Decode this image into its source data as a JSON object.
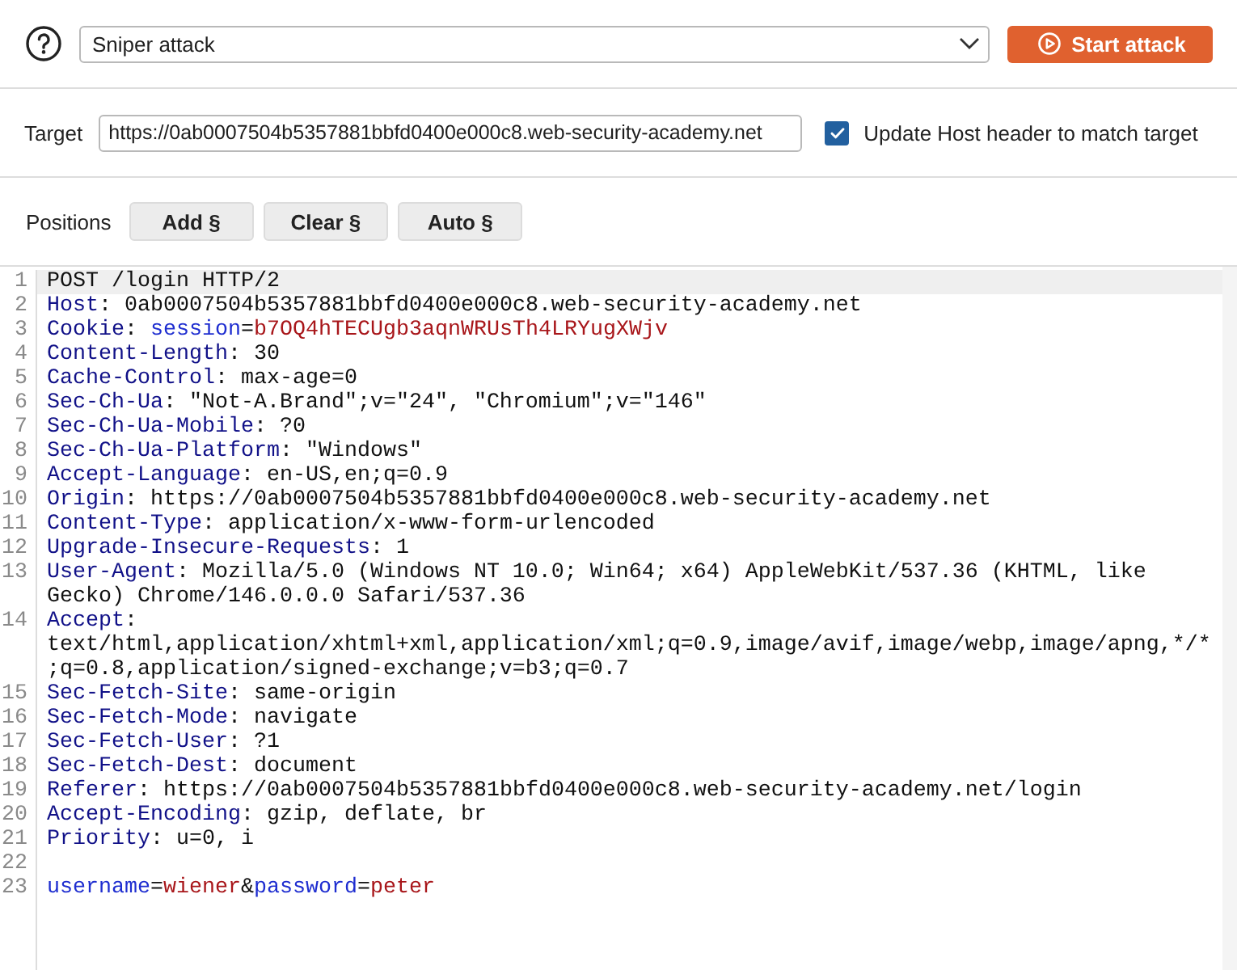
{
  "attack_type": {
    "value": "Sniper attack"
  },
  "start_attack": {
    "label": "Start attack"
  },
  "target": {
    "label": "Target",
    "value": "https://0ab0007504b5357881bbfd0400e000c8.web-security-academy.net",
    "update_host": {
      "label": "Update Host header to match target",
      "checked": true
    }
  },
  "positions": {
    "label": "Positions",
    "buttons": [
      {
        "label": "Add §"
      },
      {
        "label": "Clear §"
      },
      {
        "label": "Auto §"
      }
    ]
  },
  "editor": {
    "lines": [
      {
        "number": "1",
        "highlighted": true,
        "segments": [
          {
            "kind": "plain",
            "text": "POST /login HTTP/2"
          }
        ]
      },
      {
        "number": "2",
        "highlighted": false,
        "segments": [
          {
            "kind": "name",
            "text": "Host"
          },
          {
            "kind": "plain",
            "text": ": 0ab0007504b5357881bbfd0400e000c8.web-security-academy.net"
          }
        ]
      },
      {
        "number": "3",
        "highlighted": false,
        "segments": [
          {
            "kind": "name",
            "text": "Cookie"
          },
          {
            "kind": "plain",
            "text": ": "
          },
          {
            "kind": "param",
            "text": "session"
          },
          {
            "kind": "plain",
            "text": "="
          },
          {
            "kind": "value",
            "text": "b7OQ4hTECUgb3aqnWRUsTh4LRYugXWjv"
          }
        ]
      },
      {
        "number": "4",
        "highlighted": false,
        "segments": [
          {
            "kind": "name",
            "text": "Content-Length"
          },
          {
            "kind": "plain",
            "text": ": 30"
          }
        ]
      },
      {
        "number": "5",
        "highlighted": false,
        "segments": [
          {
            "kind": "name",
            "text": "Cache-Control"
          },
          {
            "kind": "plain",
            "text": ": max-age=0"
          }
        ]
      },
      {
        "number": "6",
        "highlighted": false,
        "segments": [
          {
            "kind": "name",
            "text": "Sec-Ch-Ua"
          },
          {
            "kind": "plain",
            "text": ": \"Not-A.Brand\";v=\"24\", \"Chromium\";v=\"146\""
          }
        ]
      },
      {
        "number": "7",
        "highlighted": false,
        "segments": [
          {
            "kind": "name",
            "text": "Sec-Ch-Ua-Mobile"
          },
          {
            "kind": "plain",
            "text": ": ?0"
          }
        ]
      },
      {
        "number": "8",
        "highlighted": false,
        "segments": [
          {
            "kind": "name",
            "text": "Sec-Ch-Ua-Platform"
          },
          {
            "kind": "plain",
            "text": ": \"Windows\""
          }
        ]
      },
      {
        "number": "9",
        "highlighted": false,
        "segments": [
          {
            "kind": "name",
            "text": "Accept-Language"
          },
          {
            "kind": "plain",
            "text": ": en-US,en;q=0.9"
          }
        ]
      },
      {
        "number": "10",
        "highlighted": false,
        "segments": [
          {
            "kind": "name",
            "text": "Origin"
          },
          {
            "kind": "plain",
            "text": ": https://0ab0007504b5357881bbfd0400e000c8.web-security-academy.net"
          }
        ]
      },
      {
        "number": "11",
        "highlighted": false,
        "segments": [
          {
            "kind": "name",
            "text": "Content-Type"
          },
          {
            "kind": "plain",
            "text": ": application/x-www-form-urlencoded"
          }
        ]
      },
      {
        "number": "12",
        "highlighted": false,
        "segments": [
          {
            "kind": "name",
            "text": "Upgrade-Insecure-Requests"
          },
          {
            "kind": "plain",
            "text": ": 1"
          }
        ]
      },
      {
        "number": "13",
        "highlighted": false,
        "segments": [
          {
            "kind": "name",
            "text": "User-Agent"
          },
          {
            "kind": "plain",
            "text": ": Mozilla/5.0 (Windows NT 10.0; Win64; x64) AppleWebKit/537.36 (KHTML, like Gecko) Chrome/146.0.0.0 Safari/537.36"
          }
        ]
      },
      {
        "number": "14",
        "highlighted": false,
        "segments": [
          {
            "kind": "name",
            "text": "Accept"
          },
          {
            "kind": "plain",
            "text": ": text/html,application/xhtml+xml,application/xml;q=0.9,image/avif,image/webp,image/apng,*/*;q=0.8,application/signed-exchange;v=b3;q=0.7"
          }
        ]
      },
      {
        "number": "15",
        "highlighted": false,
        "segments": [
          {
            "kind": "name",
            "text": "Sec-Fetch-Site"
          },
          {
            "kind": "plain",
            "text": ": same-origin"
          }
        ]
      },
      {
        "number": "16",
        "highlighted": false,
        "segments": [
          {
            "kind": "name",
            "text": "Sec-Fetch-Mode"
          },
          {
            "kind": "plain",
            "text": ": navigate"
          }
        ]
      },
      {
        "number": "17",
        "highlighted": false,
        "segments": [
          {
            "kind": "name",
            "text": "Sec-Fetch-User"
          },
          {
            "kind": "plain",
            "text": ": ?1"
          }
        ]
      },
      {
        "number": "18",
        "highlighted": false,
        "segments": [
          {
            "kind": "name",
            "text": "Sec-Fetch-Dest"
          },
          {
            "kind": "plain",
            "text": ": document"
          }
        ]
      },
      {
        "number": "19",
        "highlighted": false,
        "segments": [
          {
            "kind": "name",
            "text": "Referer"
          },
          {
            "kind": "plain",
            "text": ": https://0ab0007504b5357881bbfd0400e000c8.web-security-academy.net/login"
          }
        ]
      },
      {
        "number": "20",
        "highlighted": false,
        "segments": [
          {
            "kind": "name",
            "text": "Accept-Encoding"
          },
          {
            "kind": "plain",
            "text": ": gzip, deflate, br"
          }
        ]
      },
      {
        "number": "21",
        "highlighted": false,
        "segments": [
          {
            "kind": "name",
            "text": "Priority"
          },
          {
            "kind": "plain",
            "text": ": u=0, i"
          }
        ]
      },
      {
        "number": "22",
        "highlighted": false
      },
      {
        "number": "23",
        "highlighted": false,
        "segments": [
          {
            "kind": "param",
            "text": "username"
          },
          {
            "kind": "plain",
            "text": "="
          },
          {
            "kind": "value",
            "text": "wiener"
          },
          {
            "kind": "plain",
            "text": "&"
          },
          {
            "kind": "param",
            "text": "password"
          },
          {
            "kind": "plain",
            "text": "="
          },
          {
            "kind": "value",
            "text": "peter"
          }
        ]
      }
    ]
  }
}
